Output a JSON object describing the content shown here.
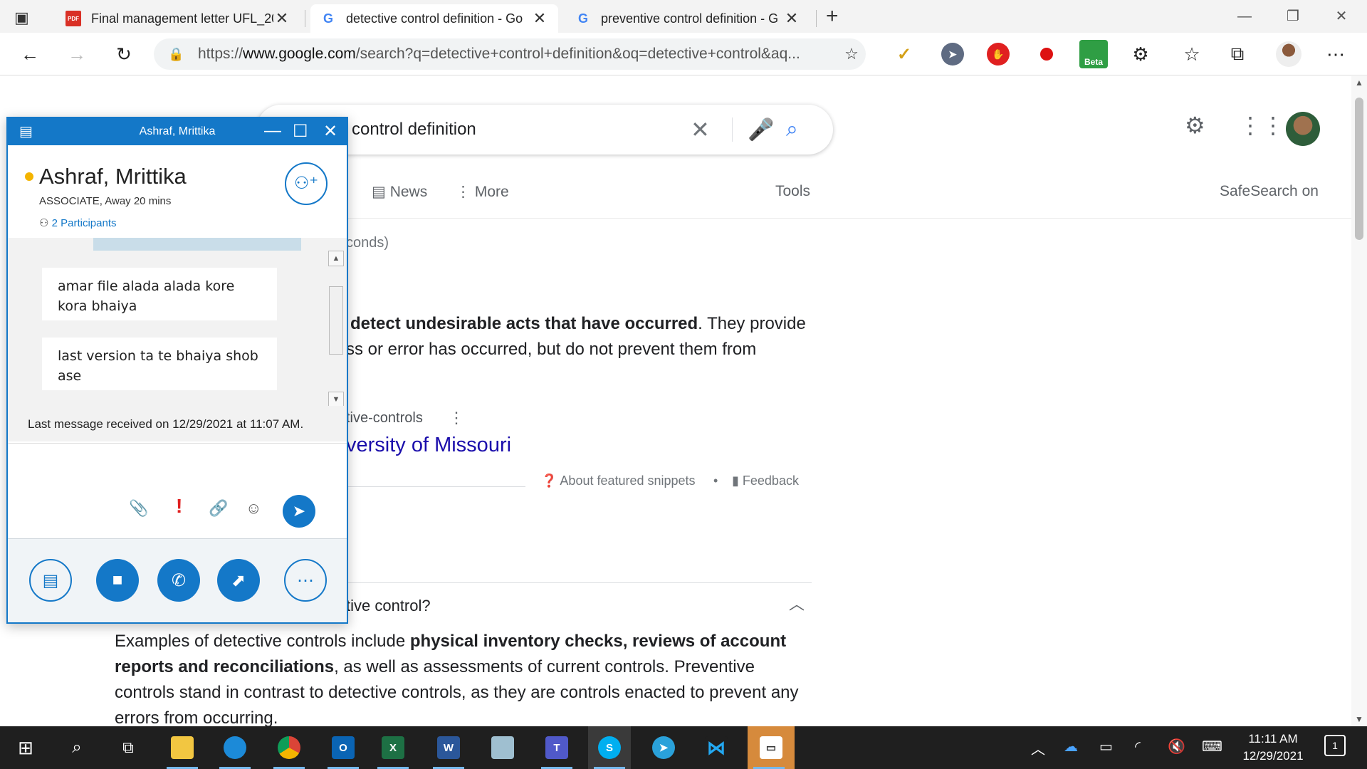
{
  "browser": {
    "tabs": [
      {
        "title": "Final management letter UFL_20",
        "favicon": "pdf-icon",
        "active": false
      },
      {
        "title": "detective control definition - Go",
        "favicon": "google-g-icon",
        "active": true
      },
      {
        "title": "preventive control definition - G",
        "favicon": "google-g-icon",
        "active": false
      }
    ],
    "close_glyph": "✕",
    "new_tab_glyph": "+",
    "url_prefix": "https://",
    "url_host": "www.google.com",
    "url_path": "/search?q=detective+control+definition&oq=detective+control&aq...",
    "extension_badge": "Beta"
  },
  "google": {
    "query_visible": "control definition",
    "nav": {
      "news": "News",
      "more": "More",
      "tools": "Tools",
      "safesearch": "SafeSearch on"
    },
    "result_stats_partial": "conds)",
    "snippet": {
      "bold_part": "detect undesirable acts that have occurred",
      "after_bold": ". They provide",
      "line2": "ss or error has occurred, but do not prevent them from"
    },
    "source_breadcrumb": "tive-controls",
    "source_title": "versity of Missouri",
    "about_snippets": "About featured snippets",
    "bullet": "•",
    "feedback": "Feedback",
    "paa_question": "tive control?",
    "answer": {
      "line1_pre": "Examples of detective controls include ",
      "line1_bold": "physical inventory checks, reviews of account",
      "line2_bold": "reports and reconciliations",
      "line2_post": ", as well as assessments of current controls. Preventive",
      "line3": "controls stand in contrast to detective controls, as they are controls enacted to prevent any",
      "line4": "errors from occurring."
    }
  },
  "skype": {
    "window_title": "Ashraf, Mrittika",
    "contact_name": "Ashraf, Mrittika",
    "role": "ASSOCIATE,",
    "presence": "Away 20 mins",
    "participants": "2 Participants",
    "messages": [
      {
        "text": "amar file alada alada kore kora bhaiya"
      },
      {
        "text": "last version ta te bhaiya shob ase"
      }
    ],
    "last_message_info": "Last message received on 12/29/2021 at 11:07 AM.",
    "status_color": "#f4b400",
    "accent_color": "#1478c8"
  },
  "taskbar": {
    "apps": [
      "start-icon",
      "search-icon",
      "task-view-icon",
      "file-explorer-icon",
      "edge-icon",
      "chrome-icon",
      "outlook-icon",
      "excel-icon",
      "word-icon",
      "notes-icon",
      "teams-icon",
      "skype-icon",
      "telegram-icon",
      "vscode-icon",
      "remote-desktop-icon"
    ],
    "time": "11:11 AM",
    "date": "12/29/2021",
    "notification_count": "1"
  }
}
